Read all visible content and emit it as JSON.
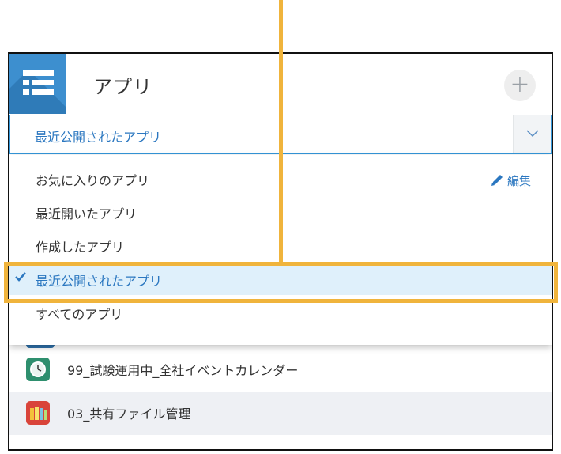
{
  "header": {
    "title": "アプリ",
    "add_label": "+"
  },
  "select": {
    "value": "最近公開されたアプリ"
  },
  "menu": {
    "edit_label": "編集",
    "items": [
      {
        "label": "お気に入りのアプリ",
        "selected": false
      },
      {
        "label": "最近開いたアプリ",
        "selected": false
      },
      {
        "label": "作成したアプリ",
        "selected": false
      },
      {
        "label": "最近公開されたアプリ",
        "selected": true
      },
      {
        "label": "すべてのアプリ",
        "selected": false
      }
    ]
  },
  "apps": [
    {
      "name": "99_試験運用中_全社イベントカレンダー",
      "icon": "clock-icon",
      "color": "#2e8f6e"
    },
    {
      "name": "03_共有ファイル管理",
      "icon": "binder-icon",
      "color": "#d9443a"
    }
  ],
  "colors": {
    "accent": "#2b77c0",
    "highlight": "#f0b43c",
    "app_header_icon": "#3d8fcf"
  }
}
